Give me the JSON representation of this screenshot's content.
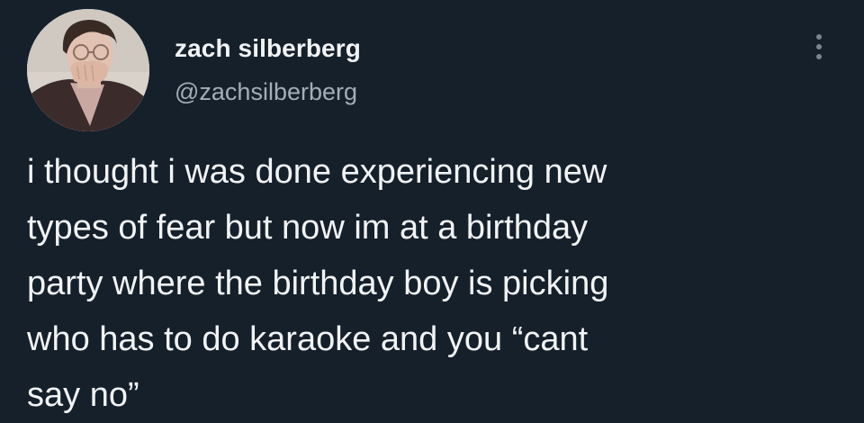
{
  "author": {
    "display_name": "zach silberberg",
    "handle": "@zachsilberberg",
    "avatar_alt": "profile photo"
  },
  "menu": {
    "icon": "more-vertical-icon"
  },
  "tweet": {
    "lines": [
      "i thought i was done experiencing new",
      "types of fear but now im at a birthday",
      "party where the birthday boy is picking",
      "who has to do karaoke and you “cant",
      "say no”"
    ]
  },
  "colors": {
    "background": "#15202b",
    "text": "#f2f3f4",
    "secondary_text": "#a5aeb7"
  }
}
